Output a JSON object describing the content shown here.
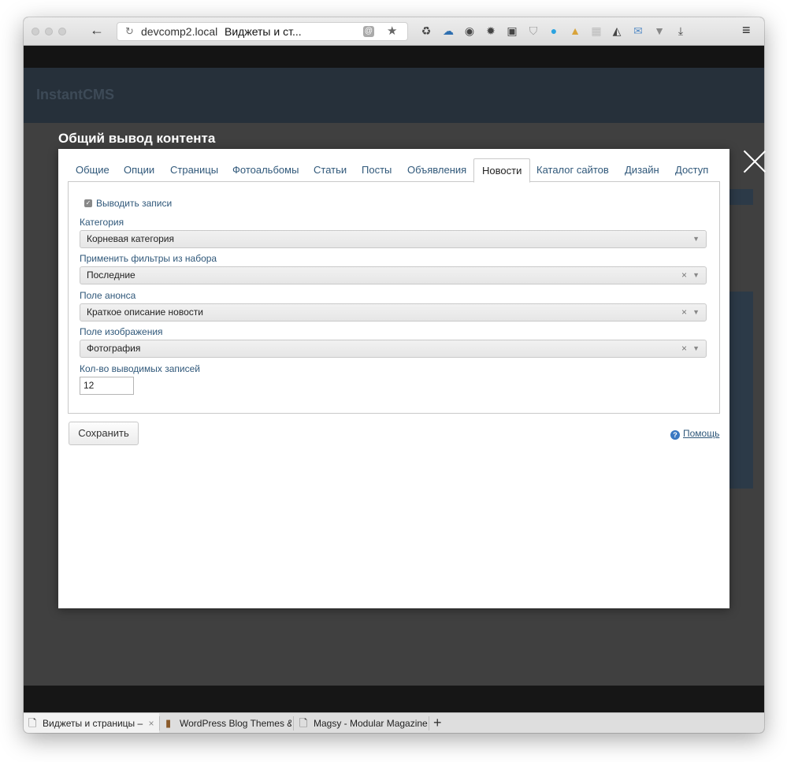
{
  "browser": {
    "url_host": "devcomp2.local",
    "page_title": "Виджеты и ст...",
    "tabs": [
      {
        "label": "Виджеты и страницы –",
        "active": true
      },
      {
        "label": "WordPress Blog Themes &",
        "active": false
      },
      {
        "label": "Magsy - Modular Magazine",
        "active": false
      }
    ],
    "close_glyph": "×",
    "newtab_glyph": "+"
  },
  "modal": {
    "title": "Общий вывод контента",
    "tabs": [
      {
        "label": "Общие"
      },
      {
        "label": "Опции"
      },
      {
        "label": "Страницы"
      },
      {
        "label": "Фотоальбомы"
      },
      {
        "label": "Статьи"
      },
      {
        "label": "Посты"
      },
      {
        "label": "Объявления"
      },
      {
        "label": "Новости"
      },
      {
        "label": "Каталог сайтов"
      },
      {
        "label": "Дизайн"
      },
      {
        "label": "Доступ"
      }
    ],
    "active_tab": "Новости",
    "show_records": {
      "label": "Выводить записи",
      "checked": true
    },
    "fields": {
      "category": {
        "label": "Категория",
        "value": "Корневая категория"
      },
      "filters": {
        "label": "Применить фильтры из набора",
        "value": "Последние"
      },
      "announce": {
        "label": "Поле анонса",
        "value": "Краткое описание новости"
      },
      "image": {
        "label": "Поле изображения",
        "value": "Фотография"
      },
      "count": {
        "label": "Кол-во выводимых записей",
        "value": "12"
      }
    },
    "save_label": "Сохранить",
    "help_label": "Помощь",
    "clear_glyph": "×",
    "arrow_glyph": "▼"
  }
}
